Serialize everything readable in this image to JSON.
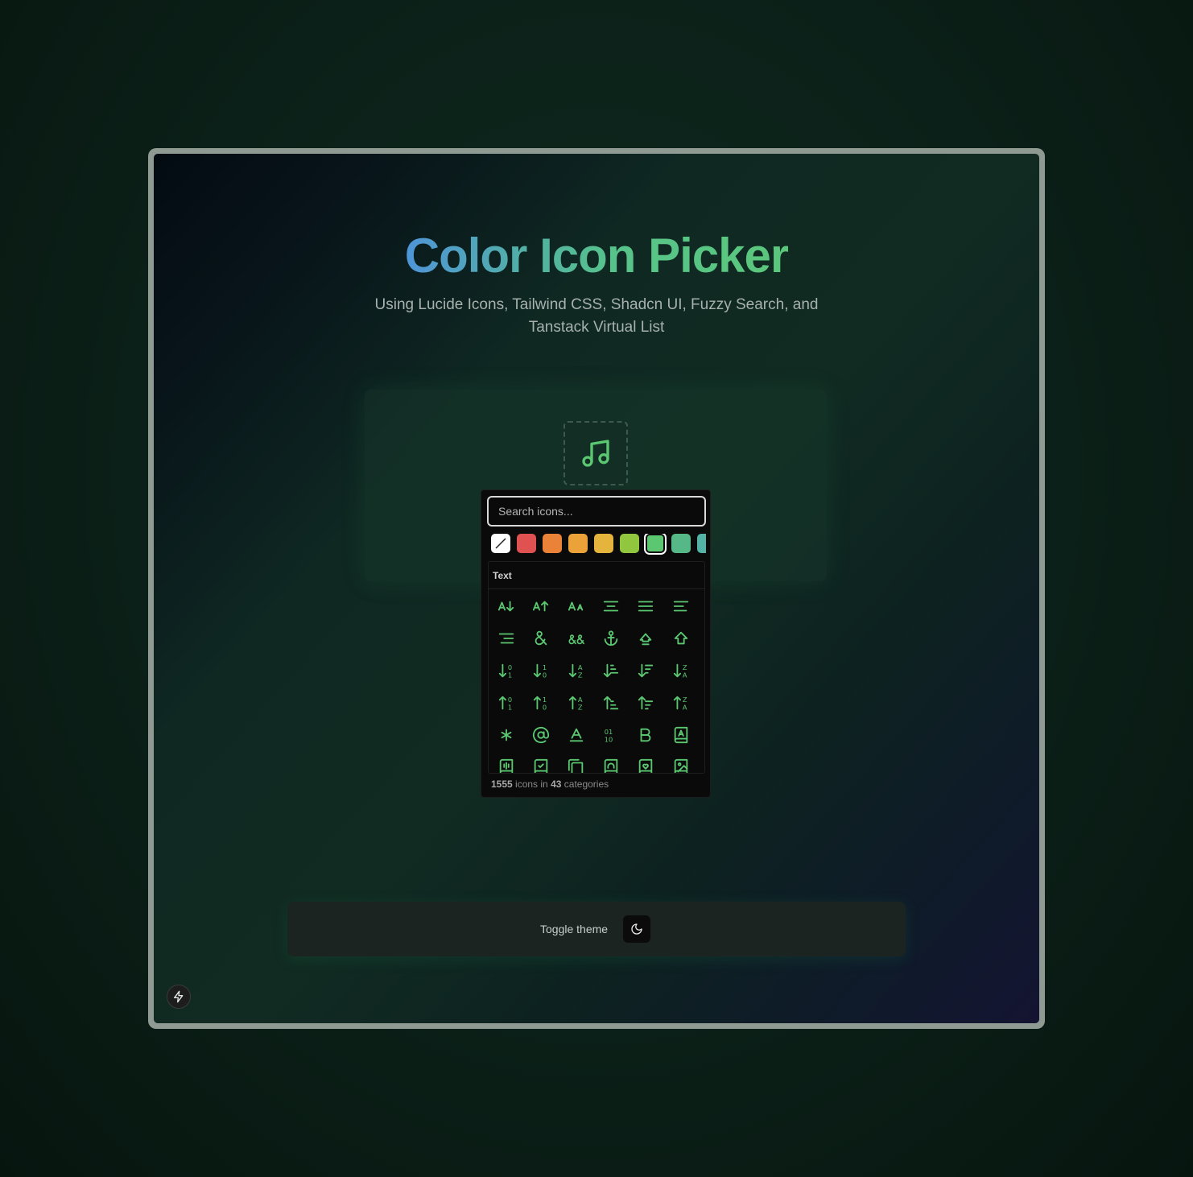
{
  "header": {
    "title": "Color Icon Picker",
    "subtitle": "Using Lucide Icons, Tailwind CSS, Shadcn UI, Fuzzy Search, and Tanstack Virtual List"
  },
  "preview": {
    "icon": "music-icon",
    "color": "#5bc771"
  },
  "picker": {
    "search_placeholder": "Search icons...",
    "swatches": [
      "none",
      "#e05252",
      "#ea8237",
      "#eba239",
      "#e4b43c",
      "#91c73f",
      "#5bc771",
      "#56b887",
      "#52b3a6"
    ],
    "selected_swatch": "#5bc771",
    "category": "Text",
    "icons": [
      "arrow-down-a-icon",
      "arrow-up-a-icon",
      "case-sensitive-icon",
      "align-center-icon",
      "align-justify-icon",
      "align-left-icon",
      "align-right-icon",
      "ampersand-icon",
      "ampersands-icon",
      "anchor-icon",
      "arrow-big-up-dash-icon",
      "arrow-big-up-icon",
      "arrow-down-0-1-icon",
      "arrow-down-1-0-icon",
      "arrow-down-a-z-icon",
      "arrow-down-narrow-wide-icon",
      "arrow-down-wide-narrow-icon",
      "arrow-down-z-a-icon",
      "arrow-up-0-1-icon",
      "arrow-up-1-0-icon",
      "arrow-up-a-z-icon",
      "arrow-up-narrow-wide-icon",
      "arrow-up-wide-narrow-icon",
      "arrow-up-z-a-icon",
      "asterisk-icon",
      "at-sign-icon",
      "baseline-icon",
      "binary-icon",
      "bold-icon",
      "book-a-icon",
      "book-audio-icon",
      "book-check-icon",
      "book-copy-icon",
      "book-headphones-icon",
      "book-heart-icon",
      "book-image-icon"
    ],
    "footer": {
      "icon_count": "1555",
      "text_1": "icons in",
      "category_count": "43",
      "text_2": "categories"
    }
  },
  "theme": {
    "toggle_label": "Toggle theme",
    "icon": "moon-icon"
  },
  "corner_button": {
    "icon": "bolt-icon"
  }
}
